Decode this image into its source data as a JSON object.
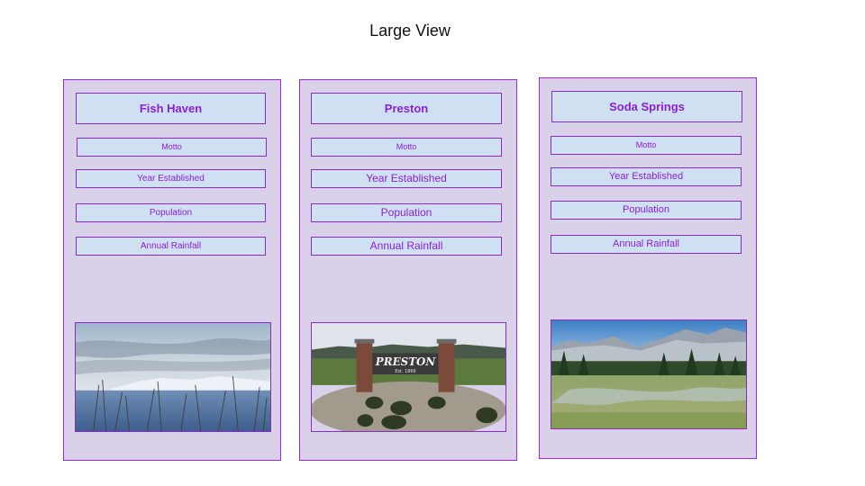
{
  "page": {
    "title": "Large View"
  },
  "cards": [
    {
      "name": "Fish Haven",
      "fields": [
        "Motto",
        "Year Established",
        "Population",
        "Annual Rainfall"
      ],
      "image": "lake-shore-snowy-hills-photo"
    },
    {
      "name": "Preston",
      "fields": [
        "Motto",
        "Year Established",
        "Population",
        "Annual Rainfall"
      ],
      "image": "preston-town-sign-photo",
      "sign_text": "PRESTON",
      "sign_subtext": "Est. 1866"
    },
    {
      "name": "Soda Springs",
      "fields": [
        "Motto",
        "Year Established",
        "Population",
        "Annual Rainfall"
      ],
      "image": "mountain-meadow-photo"
    }
  ]
}
